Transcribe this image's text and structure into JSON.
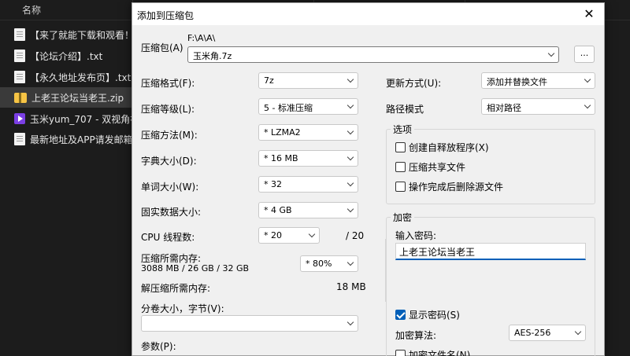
{
  "explorer": {
    "column_name": "名称",
    "files": [
      {
        "name": "【来了就能下载和观看！维",
        "icon": "text-file-icon",
        "kind": "doc"
      },
      {
        "name": "【论坛介绍】.txt",
        "icon": "text-file-icon",
        "kind": "doc"
      },
      {
        "name": "【永久地址发布页】.txt",
        "icon": "text-file-icon",
        "kind": "doc"
      },
      {
        "name": "上老王论坛当老王.zip",
        "icon": "zip-file-icon",
        "kind": "zip"
      },
      {
        "name": "玉米yum_707 - 双视角裸",
        "icon": "video-file-icon",
        "kind": "vid"
      },
      {
        "name": "最新地址及APP请发邮箱自",
        "icon": "text-file-icon",
        "kind": "doc"
      }
    ]
  },
  "dialog": {
    "title": "添加到压缩包",
    "close_glyph": "✕",
    "archive_label": "压缩包(A)",
    "archive_path": "F:\\A\\A\\",
    "archive_name": "玉米角.7z",
    "browse_label": "...",
    "format_label": "压缩格式(F):",
    "format_value": "7z",
    "level_label": "压缩等级(L):",
    "level_value": "5 - 标准压缩",
    "method_label": "压缩方法(M):",
    "method_value": "*  LZMA2",
    "dict_label": "字典大小(D):",
    "dict_value": "*  16 MB",
    "word_label": "单词大小(W):",
    "word_value": "*  32",
    "solid_label": "固实数据大小:",
    "solid_value": "*  4 GB",
    "cpu_label": "CPU 线程数:",
    "cpu_value": "*  20",
    "cpu_total": "/ 20",
    "mem_label": "压缩所需内存:",
    "mem_detail": "3088 MB / 26 GB / 32 GB",
    "mem_value": "* 80%",
    "decomp_label": "解压缩所需内存:",
    "decomp_value": "18 MB",
    "split_label": "分卷大小，字节(V):",
    "split_value": "",
    "params_label": "参数(P):",
    "update_label": "更新方式(U):",
    "update_value": "添加并替换文件",
    "path_mode_label": "路径模式",
    "path_mode_value": "相对路径",
    "options_title": "选项",
    "options": [
      {
        "label": "创建自释放程序(X)",
        "checked": false
      },
      {
        "label": "压缩共享文件",
        "checked": false
      },
      {
        "label": "操作完成后删除源文件",
        "checked": false
      }
    ],
    "encrypt_title": "加密",
    "password_label": "输入密码:",
    "password_value": "上老王论坛当老王",
    "show_password_label": "显示密码(S)",
    "show_password_checked": true,
    "enc_method_label": "加密算法:",
    "enc_method_value": "AES-256",
    "encrypt_names_label": "加密文件名(N)",
    "encrypt_names_checked": false
  },
  "colors": {
    "accent": "#005fb8",
    "dialog_bg": "#f0f0f0",
    "explorer_bg": "#1c1c1c"
  }
}
